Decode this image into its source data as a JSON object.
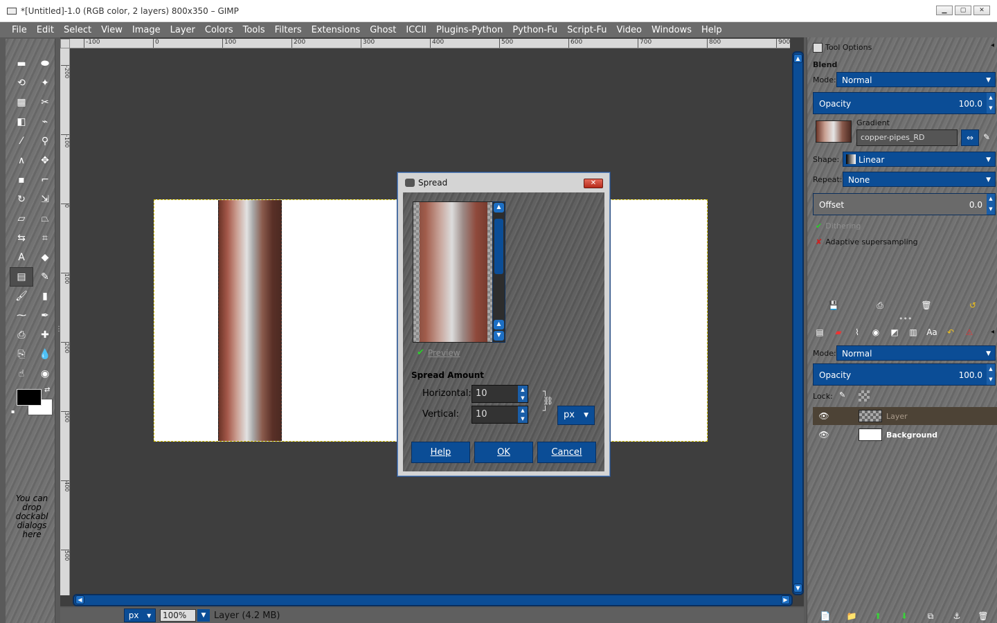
{
  "window": {
    "title": "*[Untitled]-1.0 (RGB color, 2 layers) 800x350 – GIMP",
    "controls": [
      "minimize",
      "maximize",
      "close"
    ]
  },
  "menubar": [
    "File",
    "Edit",
    "Select",
    "View",
    "Image",
    "Layer",
    "Colors",
    "Tools",
    "Filters",
    "Extensions",
    "Ghost",
    "ICCII",
    "Plugins-Python",
    "Python-Fu",
    "Script-Fu",
    "Video",
    "Windows",
    "Help"
  ],
  "toolbox": {
    "tools": [
      {
        "name": "rect-select-icon",
        "glyph": "▬"
      },
      {
        "name": "ellipse-select-icon",
        "glyph": "⬬"
      },
      {
        "name": "free-select-icon",
        "glyph": "⟲"
      },
      {
        "name": "fuzzy-select-icon",
        "glyph": "✦"
      },
      {
        "name": "select-by-color-icon",
        "glyph": "▦"
      },
      {
        "name": "scissors-icon",
        "glyph": "✂"
      },
      {
        "name": "foreground-select-icon",
        "glyph": "◧"
      },
      {
        "name": "paths-icon",
        "glyph": "⌁"
      },
      {
        "name": "color-picker-icon",
        "glyph": "⁄"
      },
      {
        "name": "zoom-icon",
        "glyph": "⚲"
      },
      {
        "name": "measure-icon",
        "glyph": "∧"
      },
      {
        "name": "move-icon",
        "glyph": "✥"
      },
      {
        "name": "align-icon",
        "glyph": "▪"
      },
      {
        "name": "crop-icon",
        "glyph": "⌐"
      },
      {
        "name": "rotate-icon",
        "glyph": "↻"
      },
      {
        "name": "scale-icon",
        "glyph": "⇲"
      },
      {
        "name": "shear-icon",
        "glyph": "▱"
      },
      {
        "name": "perspective-icon",
        "glyph": "⏢"
      },
      {
        "name": "flip-icon",
        "glyph": "⇆"
      },
      {
        "name": "cage-icon",
        "glyph": "⌗"
      },
      {
        "name": "text-icon",
        "glyph": "A"
      },
      {
        "name": "bucket-fill-icon",
        "glyph": "◆"
      },
      {
        "name": "blend-icon",
        "glyph": "▤",
        "active": true
      },
      {
        "name": "pencil-icon",
        "glyph": "✎"
      },
      {
        "name": "paintbrush-icon",
        "glyph": "🖌"
      },
      {
        "name": "eraser-icon",
        "glyph": "▮"
      },
      {
        "name": "airbrush-icon",
        "glyph": "⁓"
      },
      {
        "name": "ink-icon",
        "glyph": "✒"
      },
      {
        "name": "clone-icon",
        "glyph": "⎙"
      },
      {
        "name": "heal-icon",
        "glyph": "✚"
      },
      {
        "name": "perspective-clone-icon",
        "glyph": "⎘"
      },
      {
        "name": "blur-icon",
        "glyph": "💧"
      },
      {
        "name": "smudge-icon",
        "glyph": "☝"
      },
      {
        "name": "dodge-burn-icon",
        "glyph": "◉"
      }
    ],
    "foreground_color": "#000000",
    "background_color": "#ffffff",
    "drop_note": "You can drop dockabl dialogs here"
  },
  "ruler": {
    "horizontal": [
      "-100",
      "0",
      "100",
      "200",
      "300",
      "400",
      "500",
      "600",
      "700",
      "800",
      "900"
    ],
    "vertical": [
      "-200",
      "-100",
      "0",
      "100",
      "200",
      "300",
      "400",
      "500"
    ]
  },
  "statusbar": {
    "unit": "px",
    "zoom": "100",
    "zoom_unit": "%",
    "message": "Layer (4.2 MB)"
  },
  "tool_options": {
    "title": "Tool Options",
    "tool_name": "Blend",
    "mode_label": "Mode:",
    "mode_value": "Normal",
    "opacity_label": "Opacity",
    "opacity_value": "100.0",
    "gradient_label": "Gradient",
    "gradient_name": "copper-pipes_RD",
    "shape_label": "Shape:",
    "shape_value": "Linear",
    "repeat_label": "Repeat:",
    "repeat_value": "None",
    "offset_label": "Offset",
    "offset_value": "0.0",
    "dithering_label": "Dithering",
    "dithering_checked": true,
    "adaptive_label": "Adaptive supersampling",
    "adaptive_checked": false
  },
  "layers": {
    "mode_label": "Mode:",
    "mode_value": "Normal",
    "opacity_label": "Opacity",
    "opacity_value": "100.0",
    "lock_label": "Lock:",
    "items": [
      {
        "name": "Layer",
        "visible": true,
        "selected": true
      },
      {
        "name": "Background",
        "visible": true,
        "selected": false
      }
    ]
  },
  "dialog": {
    "title": "Spread",
    "preview_label": "Preview",
    "preview_checked": true,
    "section_label": "Spread Amount",
    "horizontal_label": "Horizontal:",
    "horizontal_value": "10",
    "vertical_label": "Vertical:",
    "vertical_value": "10",
    "unit_value": "px",
    "help_label": "Help",
    "ok_label": "OK",
    "cancel_label": "Cancel"
  },
  "colors": {
    "accent_blue": "#0b4d96",
    "canvas_bg": "#3e3e3e",
    "selection_marquee": "#d9c600"
  }
}
